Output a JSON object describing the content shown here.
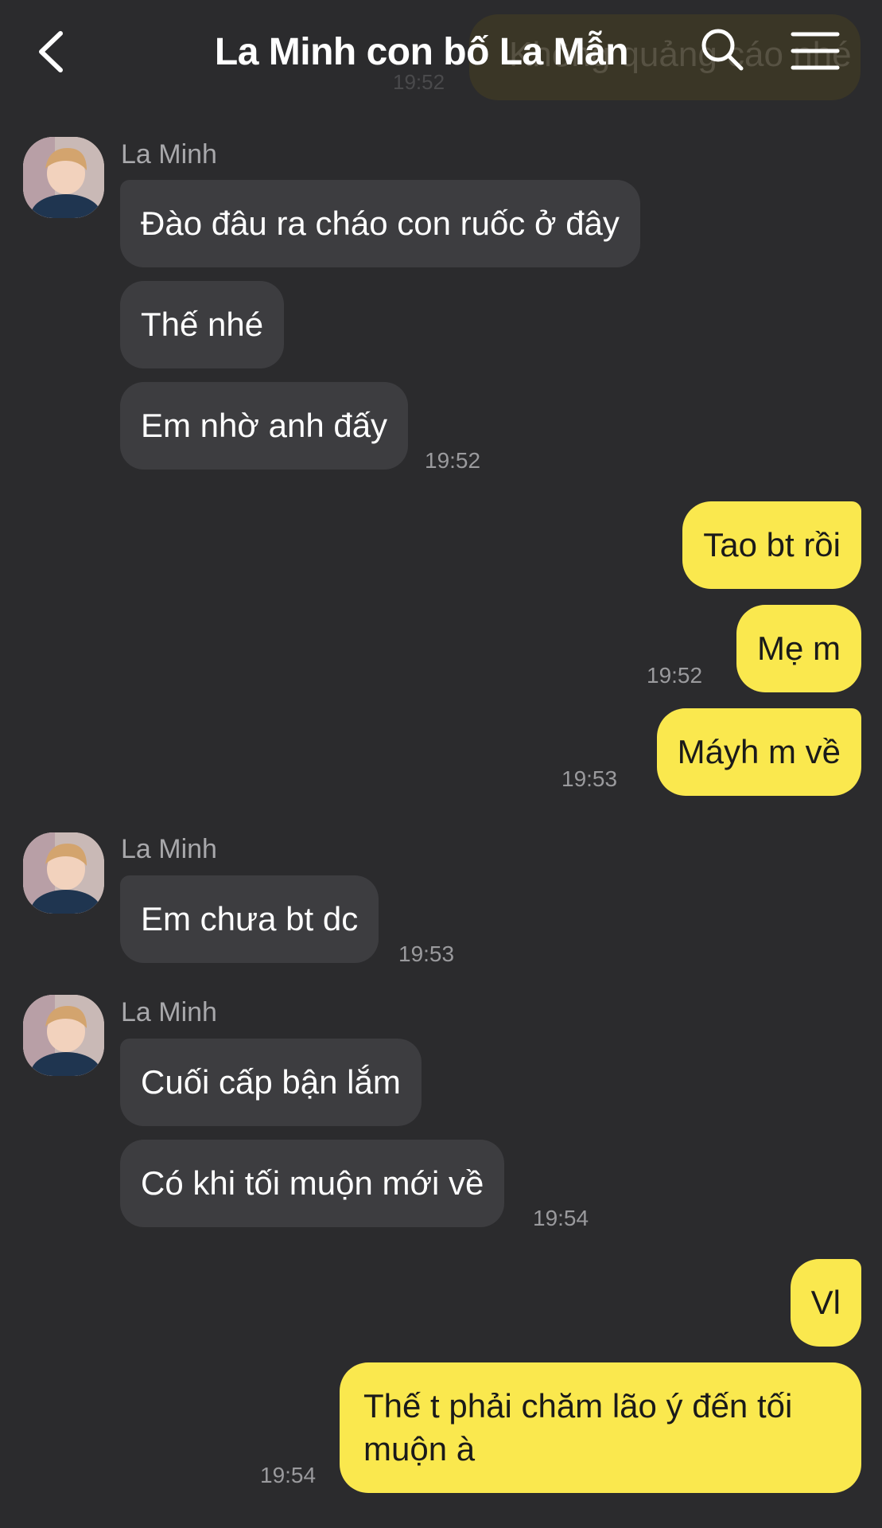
{
  "header": {
    "title": "La Minh con bố La Mẫn",
    "ghost_message": "Không quảng cáo nhé",
    "ghost_time": "19:52"
  },
  "messages": [
    {
      "sender": "La Minh",
      "text": "Đào đâu ra cháo con ruốc ở đây",
      "direction": "in"
    },
    {
      "text": "Thế nhé",
      "direction": "in"
    },
    {
      "text": "Em nhờ anh đấy",
      "direction": "in",
      "time": "19:52"
    },
    {
      "text": "Tao bt rồi",
      "direction": "out"
    },
    {
      "text": "Mẹ m",
      "direction": "out",
      "time": "19:52"
    },
    {
      "text": "Máyh m về",
      "direction": "out",
      "time": "19:53"
    },
    {
      "sender": "La Minh",
      "text": "Em chưa bt dc",
      "direction": "in",
      "time": "19:53"
    },
    {
      "sender": "La Minh",
      "text": "Cuối cấp bận lắm",
      "direction": "in"
    },
    {
      "text": "Có khi tối muộn mới về",
      "direction": "in",
      "time": "19:54"
    },
    {
      "text": "Vl",
      "direction": "out"
    },
    {
      "text": "Thế t phải chăm lão ý đến tối muộn à",
      "direction": "out",
      "time": "19:54"
    }
  ],
  "colors": {
    "background": "#2b2b2d",
    "incoming_bubble": "#3d3d40",
    "outgoing_bubble": "#fae84e"
  }
}
